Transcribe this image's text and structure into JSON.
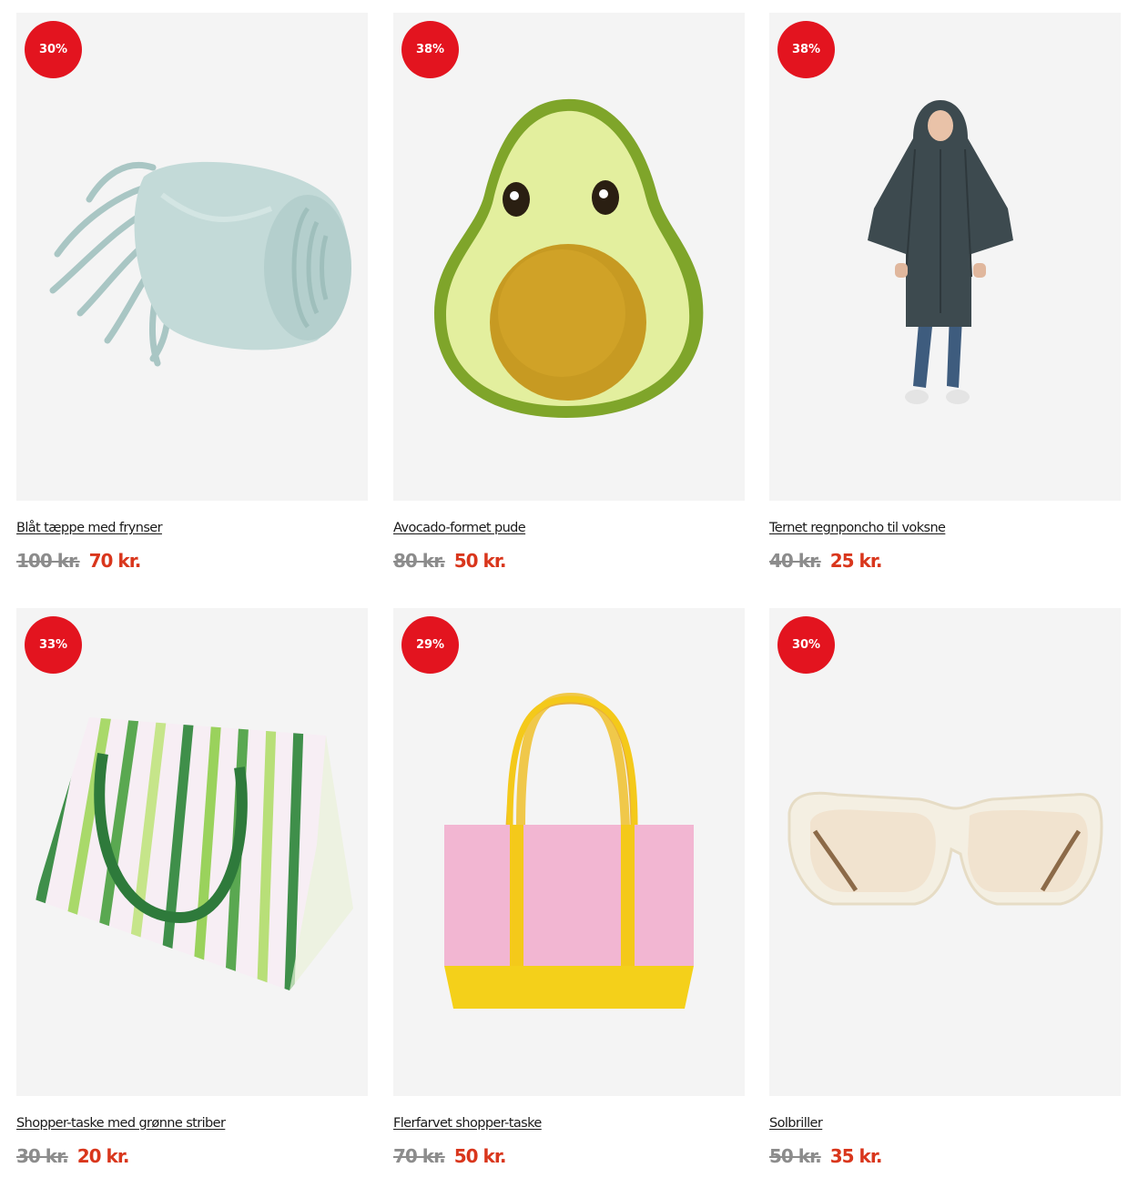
{
  "products": [
    {
      "discount": "30%",
      "title": "Blåt tæppe med frynser",
      "old_price": "100 kr.",
      "new_price": "70 kr.",
      "image_icon": "blanket-icon"
    },
    {
      "discount": "38%",
      "title": "Avocado-formet pude",
      "old_price": "80 kr.",
      "new_price": "50 kr.",
      "image_icon": "avocado-pillow-icon"
    },
    {
      "discount": "38%",
      "title": "Ternet regnponcho til voksne",
      "old_price": "40 kr.",
      "new_price": "25 kr.",
      "image_icon": "poncho-icon"
    },
    {
      "discount": "33%",
      "title": "Shopper-taske med grønne striber",
      "old_price": "30 kr.",
      "new_price": "20 kr.",
      "image_icon": "striped-bag-icon"
    },
    {
      "discount": "29%",
      "title": "Flerfarvet shopper-taske",
      "old_price": "70 kr.",
      "new_price": "50 kr.",
      "image_icon": "tote-bag-icon"
    },
    {
      "discount": "30%",
      "title": "Solbriller",
      "old_price": "50 kr.",
      "new_price": "35 kr.",
      "image_icon": "sunglasses-icon"
    }
  ],
  "colors": {
    "badge": "#e3141f",
    "sale_price": "#d9361c",
    "old_price": "#8c8c8c",
    "image_background": "#f4f4f4"
  }
}
